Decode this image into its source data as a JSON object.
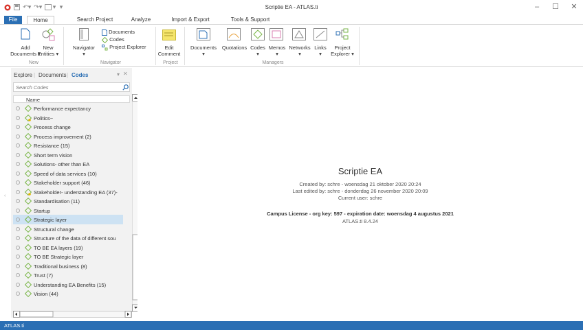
{
  "window": {
    "title": "Scriptie EA - ATLAS.ti"
  },
  "tabs": [
    "File",
    "Home",
    "Search Project",
    "Analyze",
    "Import & Export",
    "Tools & Support"
  ],
  "ribbon": {
    "new": {
      "add_documents": "Add",
      "add_documents_2": "Documents",
      "new_entities": "New",
      "new_entities_2": "Entities",
      "group": "New"
    },
    "navigator": {
      "navigator": "Navigator",
      "documents": "Documents",
      "codes": "Codes",
      "project_explorer": "Project Explorer",
      "group": "Navigator"
    },
    "project": {
      "edit_comment": "Edit",
      "edit_comment_2": "Comment",
      "group": "Project"
    },
    "managers": {
      "documents": "Documents",
      "quotations": "Quotations",
      "codes": "Codes",
      "memos": "Memos",
      "networks": "Networks",
      "links": "Links",
      "project_explorer": "Project",
      "project_explorer_2": "Explorer",
      "group": "Managers"
    }
  },
  "panel": {
    "tabs": [
      "Explore",
      "Documents",
      "Codes"
    ],
    "search_placeholder": "Search Codes",
    "column_header": "Name",
    "codes": [
      {
        "label": "Performance expectancy",
        "memo": false
      },
      {
        "label": "Politics~",
        "memo": true
      },
      {
        "label": "Process change",
        "memo": false
      },
      {
        "label": "Process improvement (2)",
        "memo": false
      },
      {
        "label": "Resistance (15)",
        "memo": false
      },
      {
        "label": "Short term vision",
        "memo": false
      },
      {
        "label": "Solutions- other than EA",
        "memo": false
      },
      {
        "label": "Speed of data services (10)",
        "memo": false
      },
      {
        "label": "Stakeholder support (46)",
        "memo": false
      },
      {
        "label": "Stakeholder- understanding EA (37)-",
        "memo": true
      },
      {
        "label": "Standardisation (11)",
        "memo": false
      },
      {
        "label": "Startup",
        "memo": false
      },
      {
        "label": "Strategic layer",
        "memo": false,
        "selected": true
      },
      {
        "label": "Structural change",
        "memo": false
      },
      {
        "label": "Structure of the data of different sou",
        "memo": false
      },
      {
        "label": "TO BE EA layers (19)",
        "memo": false
      },
      {
        "label": "TO BE Strategic layer",
        "memo": false
      },
      {
        "label": "Traditional business (8)",
        "memo": false
      },
      {
        "label": "Trust (7)",
        "memo": false
      },
      {
        "label": "Understanding EA Benefits (15)",
        "memo": false
      },
      {
        "label": "Vision (44)",
        "memo": false
      }
    ]
  },
  "main": {
    "project_title": "Scriptie EA",
    "created": "Created by: schre - woensdag 21 oktober 2020 20:24",
    "edited": "Last edited by: schre - donderdag 26 november 2020 20:09",
    "current_user": "Current user: schre",
    "license": "Campus License - org key: 597 - expiration date: woensdag 4 augustus 2021",
    "version": "ATLAS.ti 8.4.24"
  },
  "status": {
    "text": "ATLAS.ti"
  },
  "colors": {
    "accent": "#2b6fb4",
    "code_green": "#7ab648",
    "selected": "#cde2f3"
  }
}
